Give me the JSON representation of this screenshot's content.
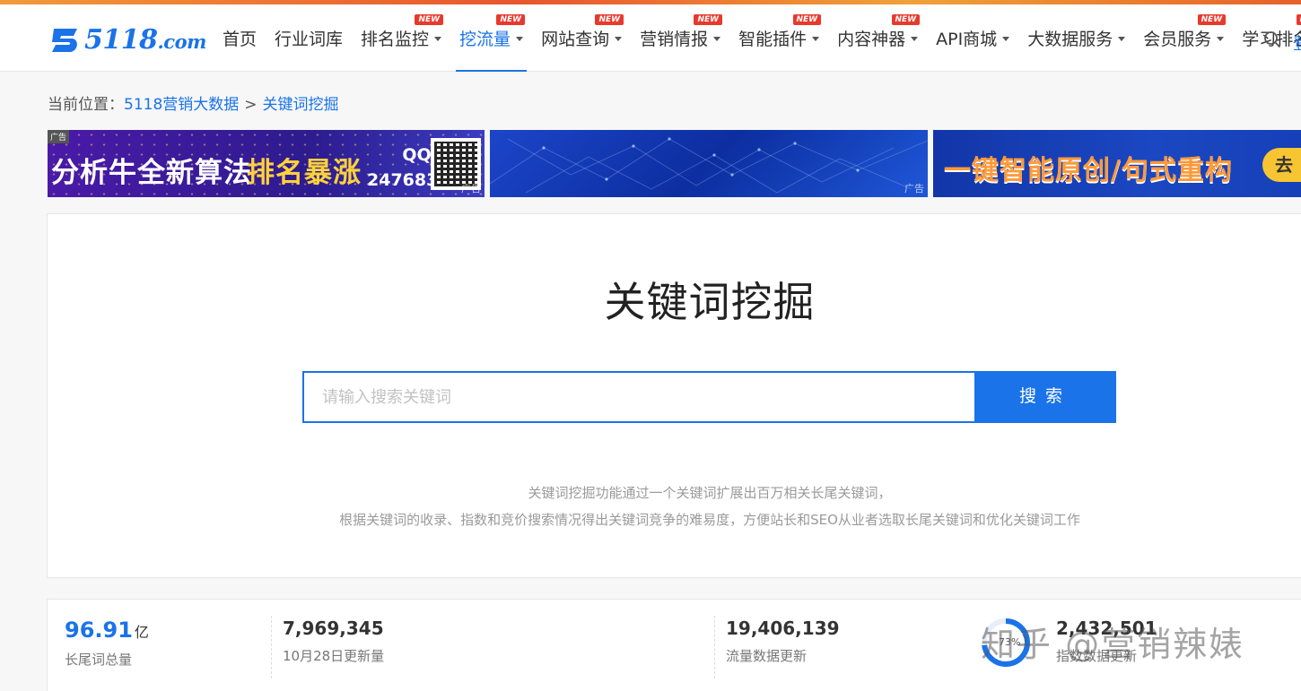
{
  "logo": {
    "text": "5118",
    "suffix": ".com"
  },
  "nav": {
    "items": [
      {
        "label": "首页",
        "new": false,
        "dropdown": false,
        "active": false
      },
      {
        "label": "行业词库",
        "new": false,
        "dropdown": false,
        "active": false
      },
      {
        "label": "排名监控",
        "new": true,
        "dropdown": true,
        "active": false
      },
      {
        "label": "挖流量",
        "new": true,
        "dropdown": true,
        "active": true
      },
      {
        "label": "网站查询",
        "new": true,
        "dropdown": true,
        "active": false
      },
      {
        "label": "营销情报",
        "new": true,
        "dropdown": true,
        "active": false
      },
      {
        "label": "智能插件",
        "new": true,
        "dropdown": true,
        "active": false
      },
      {
        "label": "内容神器",
        "new": true,
        "dropdown": true,
        "active": false
      },
      {
        "label": "API商城",
        "new": false,
        "dropdown": true,
        "active": false
      },
      {
        "label": "大数据服务",
        "new": false,
        "dropdown": true,
        "active": false
      },
      {
        "label": "会员服务",
        "new": true,
        "dropdown": true,
        "active": false
      },
      {
        "label": "学习排名",
        "new": true,
        "dropdown": true,
        "active": false
      }
    ],
    "new_badge": "NEW",
    "login_cut": "登"
  },
  "breadcrumb": {
    "prefix": "当前位置：",
    "home": "5118营销大数据",
    "sep": ">",
    "current": "关键词挖掘"
  },
  "ads": {
    "tag": "广告",
    "ad1": {
      "text1": "分析牛全新算法",
      "text2": "排名暴涨",
      "qq_label": "QQ:",
      "qq_number": "247683"
    },
    "ad3": {
      "text": "一键智能原创/句式重构",
      "button": "去"
    }
  },
  "main": {
    "title": "关键词挖掘",
    "search_placeholder": "请输入搜索关键词",
    "search_button": "搜索",
    "desc_line1": "关键词挖掘功能通过一个关键词扩展出百万相关长尾关键词，",
    "desc_line2": "根据关键词的收录、指数和竞价搜索情况得出关键词竞争的难易度，方便站长和SEO从业者选取长尾关键词和优化关键词工作"
  },
  "stats": [
    {
      "value": "96.91",
      "unit": "亿",
      "label": "长尾词总量"
    },
    {
      "value": "7,969,345",
      "unit": "",
      "label": "10月28日更新量"
    },
    {
      "value": "19,406,139",
      "unit": "",
      "label": "流量数据更新"
    },
    {
      "value": "2,432,501",
      "unit": "",
      "label": "指数数据更新"
    }
  ],
  "ring": {
    "label": "73%",
    "percent": 73
  },
  "watermark": "知乎 @营销辣婊",
  "colors": {
    "primary": "#1a73e8",
    "badge": "#e8392d"
  }
}
